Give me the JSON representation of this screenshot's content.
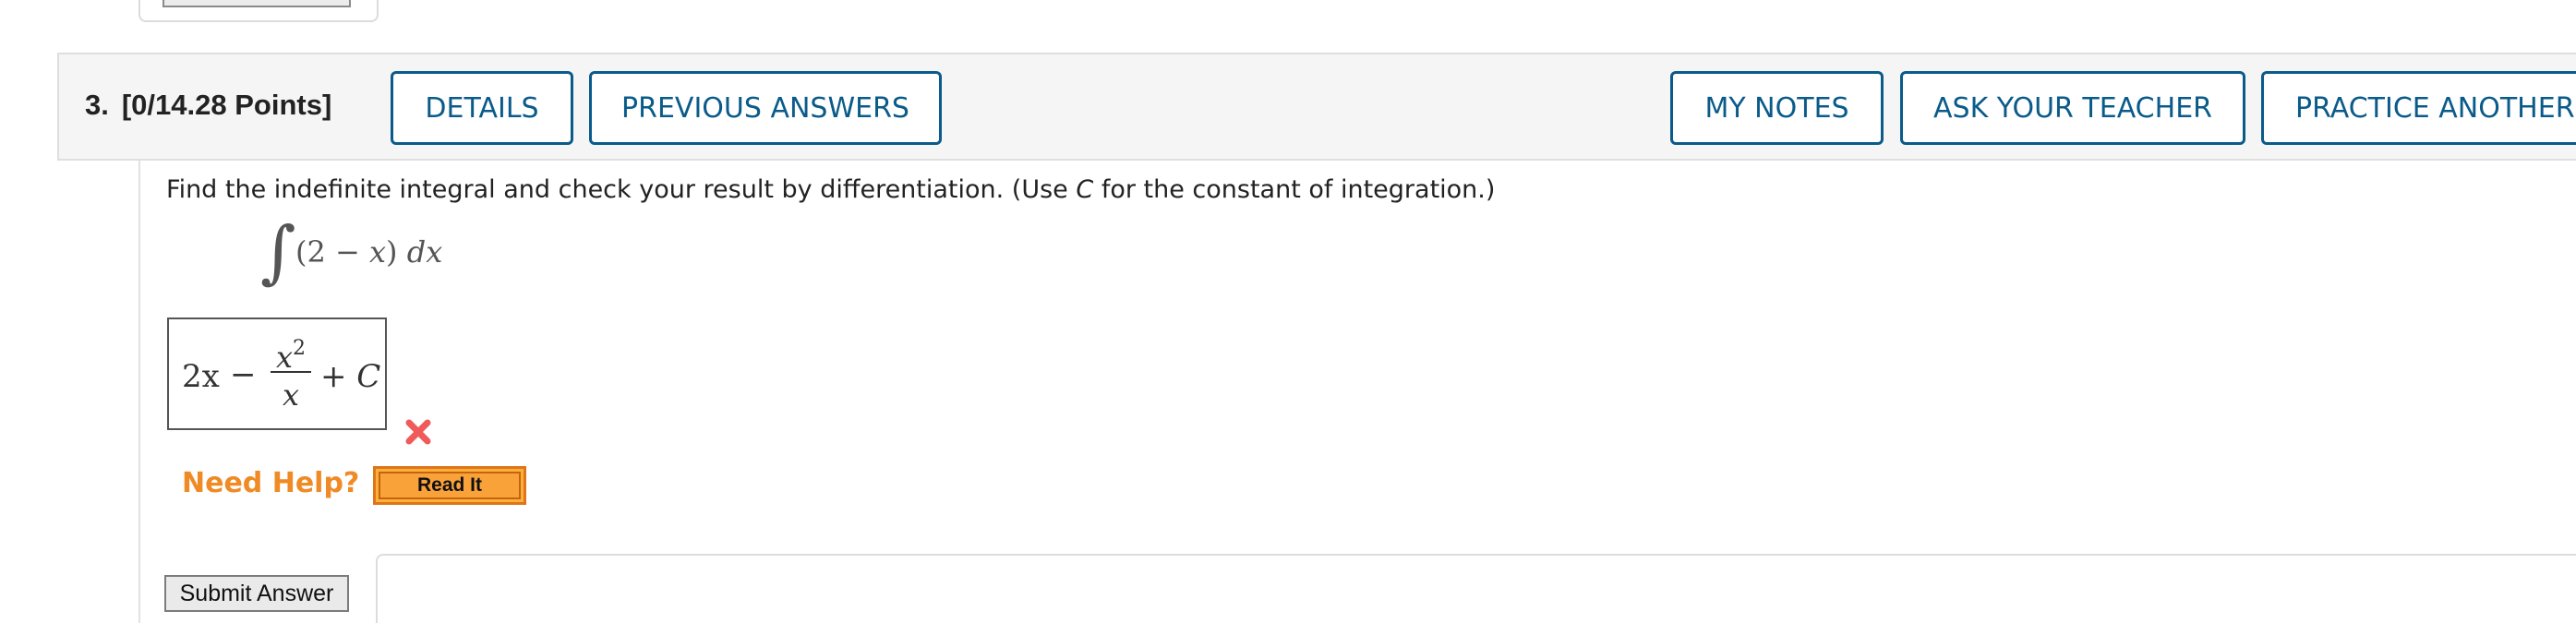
{
  "question": {
    "number": "3.",
    "points": "[0/14.28 Points]"
  },
  "header_buttons": {
    "details": "DETAILS",
    "previous_answers": "PREVIOUS ANSWERS",
    "my_notes": "MY NOTES",
    "ask_teacher": "ASK YOUR TEACHER",
    "practice_another": "PRACTICE ANOTHER"
  },
  "prompt": {
    "before": "Find the indefinite integral and check your result by differentiation. (Use ",
    "var": "C",
    "after": " for the constant of integration.)"
  },
  "integral": {
    "sign": "∫",
    "open": "(2 − ",
    "var": "x",
    "close": ")  ",
    "differential": "dx"
  },
  "answer": {
    "term1": "2x",
    "minus": "−",
    "numerator_base": "x",
    "numerator_exp": "2",
    "denominator": "x",
    "tail_plus": "+ ",
    "tail_const": "C"
  },
  "status": {
    "icon": "wrong-x-icon",
    "color": "#f05a5a"
  },
  "help": {
    "label": "Need Help?",
    "read_it": "Read It"
  },
  "submit": {
    "label": "Submit Answer"
  },
  "colors": {
    "accent": "#0a5b8a",
    "help_orange": "#f08a24",
    "button_orange": "#fbb03b"
  }
}
